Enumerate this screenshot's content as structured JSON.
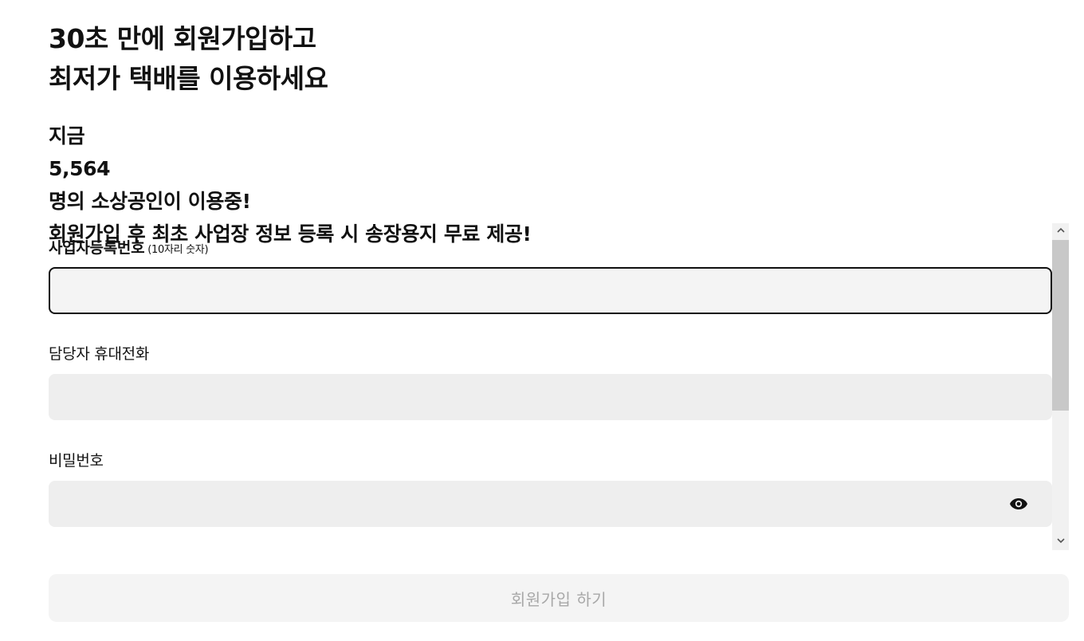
{
  "header": {
    "headline_line1": "30초 만에 회원가입하고",
    "headline_line2": "최저가 택배를 이용하세요",
    "sub_prefix": "지금 ",
    "sub_count": "5,564",
    "sub_suffix": "명의 소상공인이 이용중!",
    "sub_line2": "회원가입 후 최초 사업장 정보 등록 시 송장용지 무료 제공!"
  },
  "form": {
    "business_number": {
      "label": "사업자등록번호",
      "hint": "(10자리 숫자)",
      "value": ""
    },
    "phone": {
      "label": "담당자 휴대전화",
      "value": ""
    },
    "password": {
      "label": "비밀번호",
      "value": "",
      "toggle_icon": "eye-icon"
    }
  },
  "submit": {
    "label": "회원가입 하기"
  },
  "colors": {
    "text": "#111111",
    "input_bg": "#eeeeee",
    "focused_border": "#111111",
    "button_bg": "#f4f4f4",
    "button_text": "#a8a8a8"
  }
}
